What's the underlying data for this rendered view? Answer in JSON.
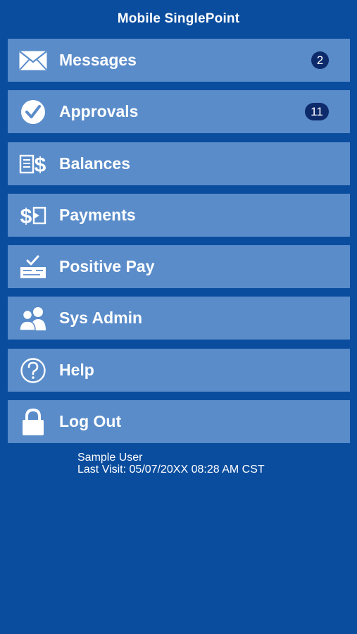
{
  "header": {
    "title": "Mobile SinglePoint"
  },
  "menu": {
    "items": [
      {
        "label": "Messages",
        "icon": "envelope-icon",
        "badge": "2"
      },
      {
        "label": "Approvals",
        "icon": "check-circle-icon",
        "badge": "11"
      },
      {
        "label": "Balances",
        "icon": "document-dollar-icon"
      },
      {
        "label": "Payments",
        "icon": "dollar-arrow-icon"
      },
      {
        "label": "Positive Pay",
        "icon": "check-document-icon"
      },
      {
        "label": "Sys Admin",
        "icon": "users-icon"
      },
      {
        "label": "Help",
        "icon": "question-circle-icon"
      },
      {
        "label": "Log Out",
        "icon": "lock-icon"
      }
    ]
  },
  "user": {
    "name": "Sample User",
    "last_visit": "Last Visit: 05/07/20XX 08:28 AM CST"
  },
  "colors": {
    "background": "#0a4d9e",
    "menu_item": "#5a8cca",
    "badge": "#0d2a6b",
    "text": "#ffffff"
  }
}
